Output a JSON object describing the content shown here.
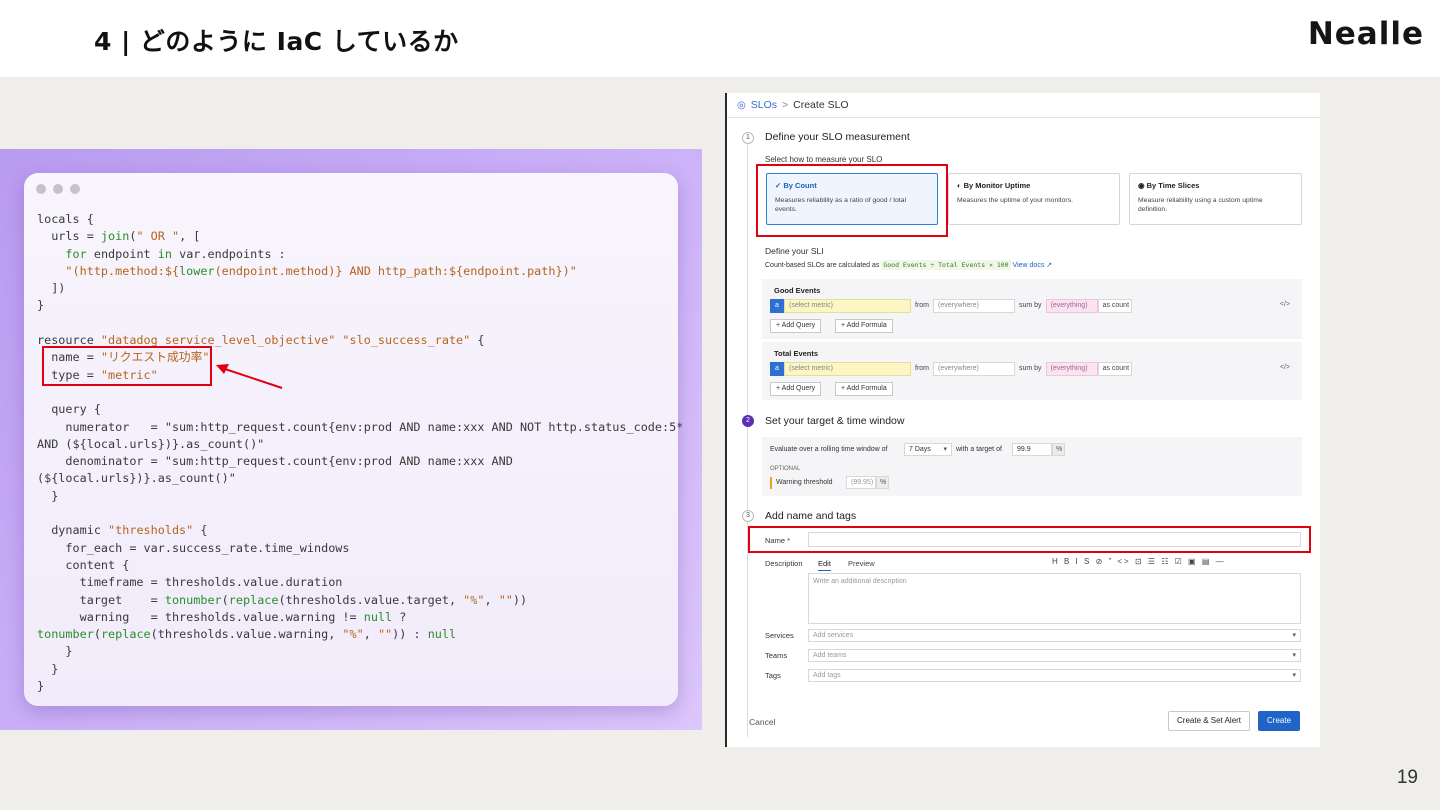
{
  "slide": {
    "title": "4 | どのように IaC しているか",
    "brand": "Nealle",
    "page_number": "19"
  },
  "code": {
    "lines": [
      "locals {",
      "  urls = join(\" OR \", [",
      "    for endpoint in var.endpoints :",
      "    \"(http.method:${lower(endpoint.method)} AND http_path:${endpoint.path})\"",
      "  ])",
      "}",
      "",
      "resource \"datadog_service_level_objective\" \"slo_success_rate\" {",
      "  name = \"リクエスト成功率\"",
      "  type = \"metric\"",
      "",
      "  query {",
      "    numerator   = \"sum:http_request.count{env:prod AND name:xxx AND NOT http.status_code:5*",
      "AND (${local.urls})}.as_count()\"",
      "    denominator = \"sum:http_request.count{env:prod AND name:xxx AND",
      "(${local.urls})}.as_count()\"",
      "  }",
      "",
      "  dynamic \"thresholds\" {",
      "    for_each = var.success_rate.time_windows",
      "    content {",
      "      timeframe = thresholds.value.duration",
      "      target    = tonumber(replace(thresholds.value.target, \"%\", \"\"))",
      "      warning   = thresholds.value.warning != null ?",
      "tonumber(replace(thresholds.value.warning, \"%\", \"\")) : null",
      "    }",
      "  }",
      "}"
    ]
  },
  "slo": {
    "breadcrumb": {
      "root": "SLOs",
      "sep": ">",
      "current": "Create SLO"
    },
    "step1": {
      "num": "1",
      "title": "Define your SLO measurement",
      "subtitle": "Select how to measure your SLO",
      "cards": [
        {
          "title": "✓ By Count",
          "desc": "Measures reliability as a ratio of good / total events."
        },
        {
          "title": "By Monitor Uptime",
          "desc": "Measures the uptime of your monitors."
        },
        {
          "title": "By Time Slices",
          "desc": "Measure reliability using a custom uptime definition."
        }
      ],
      "sli_title": "Define your SLI",
      "sli_desc": "Count-based SLOs are calculated as",
      "sli_formula": "Good Events ÷ Total Events × 100",
      "view_docs": "View docs",
      "good": {
        "title": "Good Events",
        "a": "a",
        "metric": "(select metric)",
        "from": "from",
        "where": "(everywhere)",
        "sum_by": "sum by",
        "everything": "(everything)",
        "as_count": "as count",
        "code": "</>",
        "add_query": "+ Add Query",
        "add_formula": "+ Add Formula"
      },
      "total": {
        "title": "Total Events",
        "a": "a",
        "metric": "(select metric)",
        "from": "from",
        "where": "(everywhere)",
        "sum_by": "sum by",
        "everything": "(everything)",
        "as_count": "as count",
        "code": "</>",
        "add_query": "+ Add Query",
        "add_formula": "+ Add Formula"
      }
    },
    "step2": {
      "num": "2",
      "title": "Set your target & time window",
      "evaluate": "Evaluate over a rolling time window of",
      "window": "7 Days",
      "with_target": "with a target of",
      "target": "99.9",
      "pct": "%",
      "optional": "OPTIONAL",
      "warning_label": "Warning threshold",
      "warning_ph": "(99.95)",
      "warning_pct": "%"
    },
    "step3": {
      "num": "3",
      "title": "Add name and tags",
      "name_label": "Name *",
      "desc_label": "Description",
      "tab_edit": "Edit",
      "tab_preview": "Preview",
      "toolbar": "H B I S  ⊘ ” <> ⊡  ☰ ☷ ☑  ▣ ▤ —",
      "desc_ph": "Write an additional description",
      "services_label": "Services",
      "services_ph": "Add services",
      "teams_label": "Teams",
      "teams_ph": "Add teams",
      "tags_label": "Tags",
      "tags_ph": "Add tags"
    },
    "footer": {
      "cancel": "Cancel",
      "create_alert": "Create & Set Alert",
      "create": "Create"
    }
  }
}
